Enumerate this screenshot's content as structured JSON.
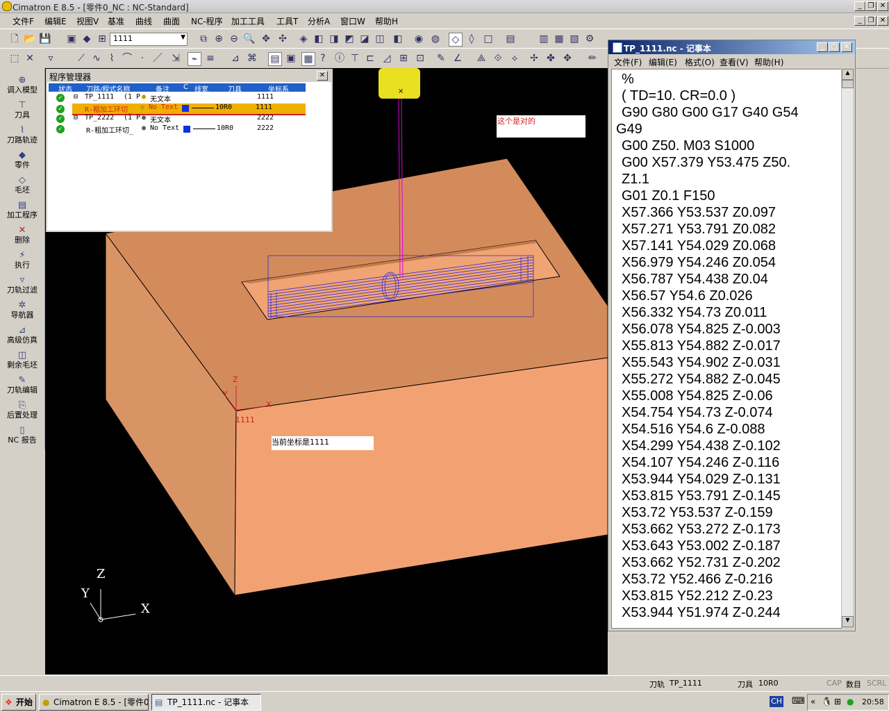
{
  "window_title": "Cimatron E 8.5 - [零件0_NC : NC-Standard]",
  "menu": [
    "文件F",
    "编辑E",
    "视图V",
    "基准",
    "曲线",
    "曲面",
    "NC-程序",
    "加工工具",
    "工具T",
    "分析A",
    "窗口W",
    "帮助H"
  ],
  "toolbar": {
    "combo_value": "1111"
  },
  "sidebar": {
    "items": [
      {
        "label": "调入模型",
        "icon": "import-model-icon"
      },
      {
        "label": "刀具",
        "icon": "tool-icon"
      },
      {
        "label": "刀路轨迹",
        "icon": "toolpath-icon"
      },
      {
        "label": "零件",
        "icon": "part-icon"
      },
      {
        "label": "毛坯",
        "icon": "stock-icon"
      },
      {
        "label": "加工程序",
        "icon": "program-icon"
      },
      {
        "label": "删除",
        "icon": "delete-icon"
      },
      {
        "label": "执行",
        "icon": "execute-icon"
      },
      {
        "label": "刀轨过滤",
        "icon": "filter-icon"
      },
      {
        "label": "导航器",
        "icon": "navigator-icon"
      },
      {
        "label": "高级仿真",
        "icon": "simulation-icon"
      },
      {
        "label": "剩余毛坯",
        "icon": "remaining-stock-icon"
      },
      {
        "label": "刀轨编辑",
        "icon": "edit-toolpath-icon"
      },
      {
        "label": "后置处理",
        "icon": "post-process-icon"
      },
      {
        "label": "NC 报告",
        "icon": "report-icon"
      }
    ]
  },
  "program_manager": {
    "title": "程序管理器",
    "columns": [
      "状态",
      "刀路/程式名称",
      "备注",
      "C",
      "线宽",
      "刀具",
      "坐标系"
    ],
    "rows": [
      {
        "name": "TP_1111",
        "extra": "(1 P",
        "note": "无文本",
        "tool": "",
        "cs": "1111",
        "selected": false,
        "child": false
      },
      {
        "name": "R-粗加工环切_",
        "extra": "",
        "note": "No Text",
        "tool": "10R0",
        "cs": "1111",
        "selected": true,
        "child": true
      },
      {
        "name": "TP_2222",
        "extra": "(1 P",
        "note": "无文本",
        "tool": "",
        "cs": "2222",
        "selected": false,
        "child": false
      },
      {
        "name": "R-粗加工环切_",
        "extra": "",
        "note": "No Text",
        "tool": "10R0",
        "cs": "2222",
        "selected": false,
        "child": true
      }
    ]
  },
  "viewport": {
    "annotation_top": "这个是对的",
    "annotation_bottom": "当前坐标是1111",
    "cs_label": "1111",
    "axis_x": "X",
    "axis_y": "Y",
    "axis_z": "Z"
  },
  "notepad": {
    "title": "TP_1111.nc - 记事本",
    "menu": [
      "文件(F)",
      "编辑(E)",
      "格式(O)",
      "查看(V)",
      "帮助(H)"
    ],
    "lines": [
      "%",
      "( TD=10. CR=0.0 )",
      "G90 G80 G00 G17 G40 G54",
      "G49",
      "G00 Z50. M03 S1000",
      "G00 X57.379 Y53.475 Z50.",
      "Z1.1",
      "G01 Z0.1 F150",
      "X57.366 Y53.537 Z0.097",
      "X57.271 Y53.791 Z0.082",
      "X57.141 Y54.029 Z0.068",
      "X56.979 Y54.246 Z0.054",
      "X56.787 Y54.438 Z0.04",
      "X56.57 Y54.6 Z0.026",
      "X56.332 Y54.73 Z0.011",
      "X56.078 Y54.825 Z-0.003",
      "X55.813 Y54.882 Z-0.017",
      "X55.543 Y54.902 Z-0.031",
      "X55.272 Y54.882 Z-0.045",
      "X55.008 Y54.825 Z-0.06",
      "X54.754 Y54.73 Z-0.074",
      "X54.516 Y54.6 Z-0.088",
      "X54.299 Y54.438 Z-0.102",
      "X54.107 Y54.246 Z-0.116",
      "X53.944 Y54.029 Z-0.131",
      "X53.815 Y53.791 Z-0.145",
      "X53.72 Y53.537 Z-0.159",
      "X53.662 Y53.272 Z-0.173",
      "X53.643 Y53.002 Z-0.187",
      "X53.662 Y52.731 Z-0.202",
      "X53.72 Y52.466 Z-0.216",
      "X53.815 Y52.212 Z-0.23",
      "X53.944 Y51.974 Z-0.244"
    ]
  },
  "status": {
    "toolpath_label": "刀轨",
    "toolpath_value": "TP_1111",
    "tool_label": "刀具",
    "tool_value": "10R0",
    "cap": "CAP",
    "num": "数目",
    "scrl": "SCRL"
  },
  "taskbar": {
    "start": "开始",
    "tasks": [
      "Cimatron E 8.5 - [零件0...",
      "TP_1111.nc - 记事本"
    ],
    "lang": "CH",
    "time": "20:58"
  },
  "colors": {
    "part_top": "#d48b5c",
    "part_front": "#f2a272",
    "part_left": "#d99466",
    "toolpath": "#2020e0",
    "tool_holder": "#e8e020",
    "selected_row": "#f0b000"
  }
}
